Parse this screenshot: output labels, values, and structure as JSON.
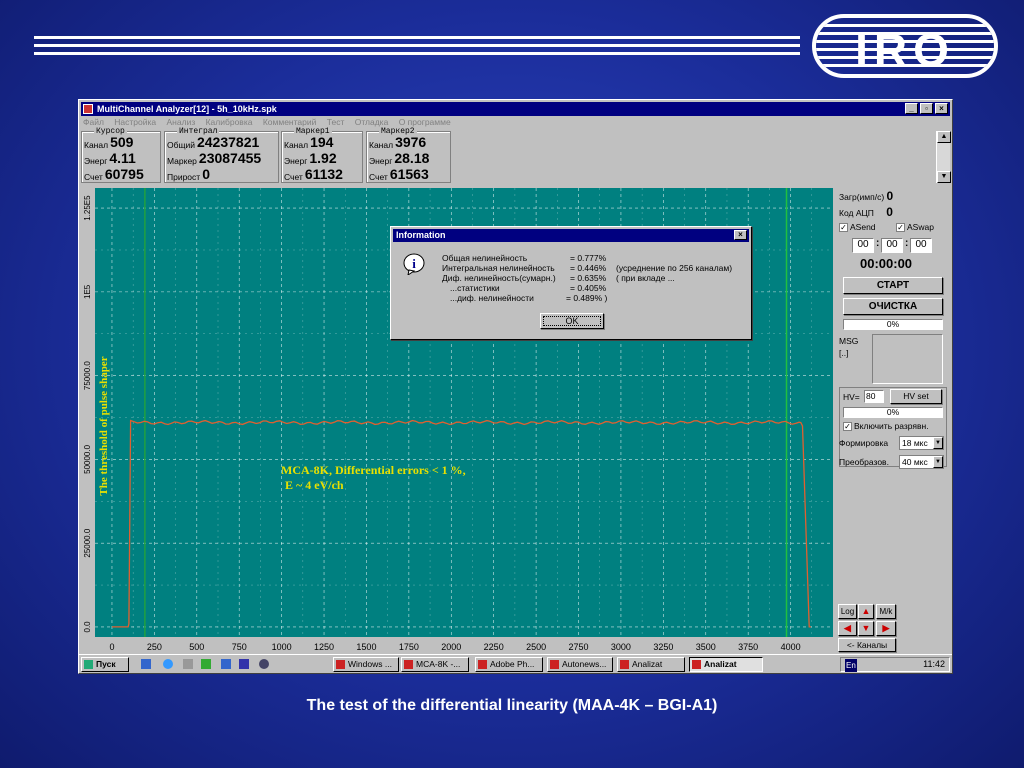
{
  "slide": {
    "caption": "The test of the differential linearity (MAA-4K – BGI-A1)",
    "logo_text": "IRO"
  },
  "window": {
    "title": "MultiChannel Analyzer[12] - 5h_10kHz.spk",
    "buttons": {
      "minimize": "_",
      "maximize": "▫",
      "close": "×"
    },
    "menu": [
      "Файл",
      "Настройка",
      "Анализ",
      "Калибровка",
      "Комментарий",
      "Тест",
      "Отладка",
      "О программе"
    ]
  },
  "info_boxes": {
    "cursor": {
      "legend": "Курсор",
      "rows": [
        {
          "label": "Канал",
          "value": "509"
        },
        {
          "label": "Энерг",
          "value": "4.11"
        },
        {
          "label": "Счет",
          "value": "60795"
        }
      ]
    },
    "integral": {
      "legend": "Интеграл",
      "rows": [
        {
          "label": "Общий",
          "value": "24237821"
        },
        {
          "label": "Маркер",
          "value": "23087455"
        },
        {
          "label": "Прирост",
          "value": "0"
        }
      ]
    },
    "marker1": {
      "legend": "Маркер1",
      "rows": [
        {
          "label": "Канал",
          "value": "194"
        },
        {
          "label": "Энерг",
          "value": "1.92"
        },
        {
          "label": "Счет",
          "value": "61132"
        }
      ]
    },
    "marker2": {
      "legend": "Маркер2",
      "rows": [
        {
          "label": "Канал",
          "value": "3976"
        },
        {
          "label": "Энерг",
          "value": "28.18"
        },
        {
          "label": "Счет",
          "value": "61563"
        }
      ]
    }
  },
  "chart_data": {
    "type": "line",
    "x_ticks": [
      0,
      250,
      500,
      750,
      1000,
      1250,
      1500,
      1750,
      2000,
      2250,
      2500,
      2750,
      3000,
      3250,
      3500,
      3750,
      4000
    ],
    "y_tick_labels": [
      "0.0",
      "25000.0",
      "50000.0",
      "75000.0",
      "1E5",
      "1.25E5"
    ],
    "y_ticks": [
      0,
      25000,
      50000,
      75000,
      100000,
      125000
    ],
    "xlim": [
      -100,
      4250
    ],
    "ylim": [
      -3000,
      131000
    ],
    "grid": true,
    "background": "#008080",
    "line_color": "#e06030",
    "series": {
      "x": [
        0,
        95,
        100,
        110,
        4060,
        4070,
        4110,
        4120
      ],
      "y": [
        0,
        0,
        900,
        61000,
        61000,
        60000,
        0,
        0
      ]
    },
    "markers": [
      {
        "x": 194,
        "color": "#20a040"
      },
      {
        "x": 3976,
        "color": "#20c040"
      }
    ],
    "annotations": {
      "vertical": "The threshold of pulse shaper",
      "title_line1": "MCA-8K, Differential errors < 1 %,",
      "title_line2": "E ~ 4 eV/ch"
    }
  },
  "right_panel": {
    "load_label": "Загр(имп/с)",
    "load_value": "0",
    "adc_label": "Код АЦП",
    "adc_value": "0",
    "asend_label": "ASend",
    "aswap_label": "ASwap",
    "time_fields": [
      "00",
      "00",
      "00"
    ],
    "time_sep": ":",
    "time_total": "00:00:00",
    "start_button": "СТАРТ",
    "clear_button": "ОЧИСТКА",
    "progress1": "0%",
    "msg_label": "MSG",
    "msg_sub": "[..]",
    "hv_label": "HV=",
    "hv_value": "80",
    "hv_set_button": "HV set",
    "progress2": "0%",
    "enable_label": "Включить разрявн.",
    "shaping_label": "Формировка",
    "shaping_value": "18 мкс",
    "conversion_label": "Преобразов.",
    "conversion_value": "40 мкс",
    "log_button": "Log",
    "mk_button": "M/k",
    "channels_button": "<- Каналы"
  },
  "dialog": {
    "title": "Information",
    "close": "×",
    "lines": [
      {
        "label": "Общая нелинейность",
        "value": "= 0.777%",
        "note": ""
      },
      {
        "label": "Интегральная нелинейность",
        "value": "= 0.446%",
        "note": "(усреднение по 256 каналам)"
      },
      {
        "label": "Диф. нелинейность(сумарн.)",
        "value": "= 0.635%",
        "note": "( при вкладе ..."
      },
      {
        "label": "...статистики",
        "value": "= 0.405%",
        "note": ""
      },
      {
        "label": "...диф. нелинейности",
        "value": "= 0.489% )",
        "note": ""
      }
    ],
    "ok": "OK"
  },
  "taskbar": {
    "start": "Пуск",
    "tasks": [
      "Windows ...",
      "MCA-8K -...",
      "Adobe Ph...",
      "Autonews...",
      "Analizat",
      "Analizat"
    ],
    "clock": "11:42",
    "tray_lang": "En"
  }
}
